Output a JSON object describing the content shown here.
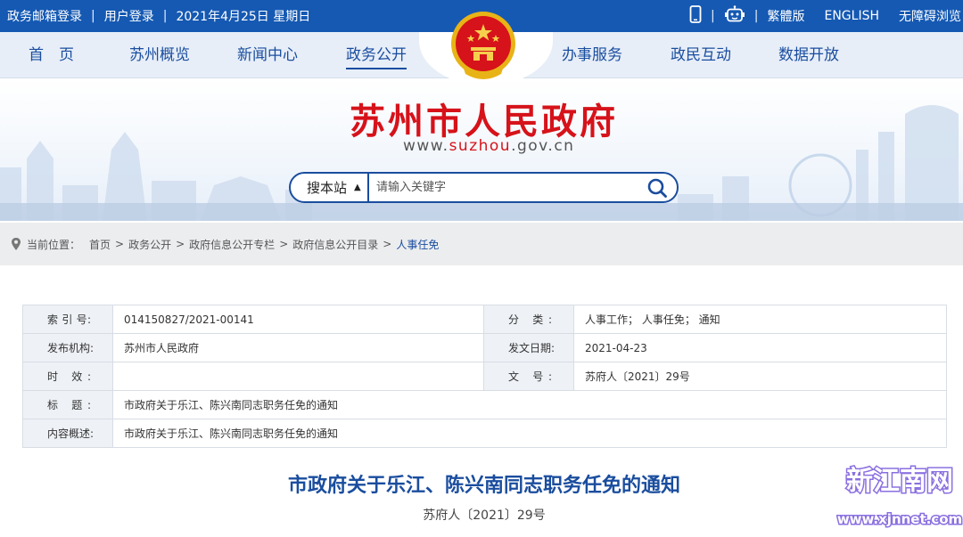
{
  "topbar": {
    "mail_login": "政务邮箱登录",
    "user_login": "用户登录",
    "date": "2021年4月25日 星期日",
    "traditional": "繁體版",
    "english": "ENGLISH",
    "accessible": "无障碍浏览",
    "sep": "|"
  },
  "nav": {
    "items": [
      "首　页",
      "苏州概览",
      "新闻中心",
      "政务公开",
      "办事服务",
      "政民互动",
      "数据开放"
    ]
  },
  "banner": {
    "title": "苏州市人民政府",
    "site_prefix": "www.",
    "site_highlight": "suzhou",
    "site_suffix": ".gov.cn"
  },
  "search": {
    "scope": "搜本站",
    "placeholder": "请输入关键字"
  },
  "breadcrumb": {
    "label": "当前位置：",
    "items": [
      "首页",
      "政务公开",
      "政府信息公开专栏",
      "政府信息公开目录",
      "人事任免"
    ],
    "arrow": ">"
  },
  "meta": {
    "index_label": "索 引 号:",
    "index_value": "014150827/2021-00141",
    "category_label": "分 类:",
    "category_value": "人事工作；  人事任免；  通知",
    "publisher_label": "发布机构:",
    "publisher_value": "苏州市人民政府",
    "date_label": "发文日期:",
    "date_value": "2021-04-23",
    "validity_label": "时 效:",
    "validity_value": "",
    "docno_label": "文 号:",
    "docno_value": "苏府人〔2021〕29号",
    "title_label": "标 题:",
    "title_value": "市政府关于乐江、陈兴南同志职务任免的通知",
    "summary_label": "内容概述:",
    "summary_value": "市政府关于乐江、陈兴南同志职务任免的通知"
  },
  "document": {
    "title": "市政府关于乐江、陈兴南同志职务任免的通知",
    "number": "苏府人〔2021〕29号"
  },
  "watermark": {
    "name": "新江南网",
    "url": "www.xjnnet.com"
  },
  "colors": {
    "topbar": "#1559b3",
    "nav_text": "#1a4d9e",
    "title_red": "#d6121a",
    "doc_title": "#1a4d9e",
    "watermark": "#8a6fe0"
  }
}
